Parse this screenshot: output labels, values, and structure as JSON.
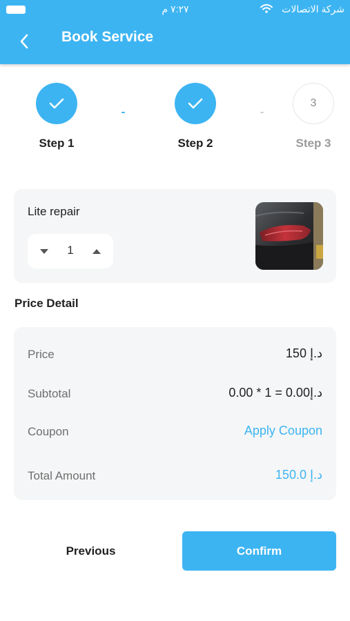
{
  "status_bar": {
    "carrier": "شركة الاتصالات",
    "time": "٧:٢٧ م"
  },
  "header": {
    "title": "Book Service",
    "back_icon": "chevron-left-icon"
  },
  "stepper": {
    "steps": [
      {
        "label": "Step 1",
        "state": "done",
        "marker": "check-icon"
      },
      {
        "label": "Step 2",
        "state": "done",
        "marker": "check-icon"
      },
      {
        "label": "Step 3",
        "state": "todo",
        "marker": "3"
      }
    ]
  },
  "service": {
    "name": "Lite repair",
    "quantity": "1",
    "image": "car-tail-light-photo"
  },
  "price_detail": {
    "title": "Price Detail",
    "rows": [
      {
        "label": "Price",
        "value": "د.إ 150"
      },
      {
        "label": "Subtotal",
        "value": "د.إ0.00 = 1 * 0.00"
      },
      {
        "label": "Coupon",
        "value": "Apply Coupon"
      },
      {
        "label": "Total Amount",
        "value": "د.إ 150.0"
      }
    ]
  },
  "actions": {
    "previous_label": "Previous",
    "confirm_label": "Confirm"
  },
  "colors": {
    "primary": "#3db4f2",
    "card_bg": "#f5f6f7",
    "text": "#1f1f1f",
    "muted": "#6e6e6e"
  }
}
